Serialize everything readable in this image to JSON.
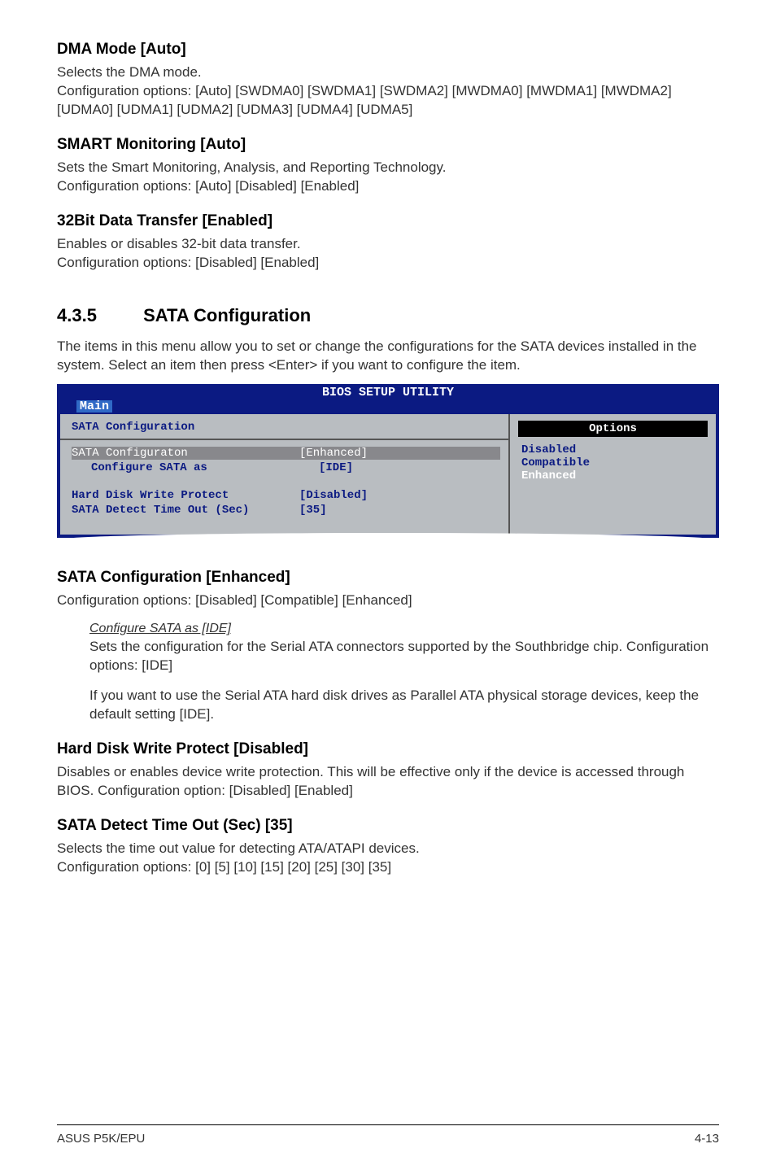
{
  "sections": {
    "dma": {
      "title": "DMA Mode [Auto]",
      "line1": "Selects the DMA mode.",
      "line2": "Configuration options: [Auto] [SWDMA0] [SWDMA1] [SWDMA2] [MWDMA0] [MWDMA1] [MWDMA2] [UDMA0] [UDMA1] [UDMA2] [UDMA3] [UDMA4] [UDMA5]"
    },
    "smart": {
      "title": "SMART Monitoring [Auto]",
      "line1": "Sets the Smart Monitoring, Analysis, and Reporting Technology.",
      "line2": "Configuration options: [Auto] [Disabled] [Enabled]"
    },
    "transfer": {
      "title": "32Bit Data Transfer [Enabled]",
      "line1": "Enables or disables 32-bit data transfer.",
      "line2": "Configuration options: [Disabled] [Enabled]"
    },
    "sataconfig": {
      "num": "4.3.5",
      "title": "SATA Configuration",
      "intro": "The items in this menu allow you to set or change the configurations for the SATA devices installed in the system. Select an item then press <Enter> if you want to configure the item."
    },
    "sataenhanced": {
      "title": "SATA Configuration [Enhanced]",
      "line1": "Configuration options: [Disabled] [Compatible] [Enhanced]",
      "sub_title": "Configure SATA as [IDE]",
      "sub_line1": "Sets the configuration for the Serial ATA connectors supported by the Southbridge chip. Configuration options: [IDE]",
      "sub_line2": "If you want to use the Serial ATA hard disk drives as Parallel ATA physical storage devices, keep the default setting [IDE]."
    },
    "hdwp": {
      "title": "Hard Disk Write Protect [Disabled]",
      "line1": "Disables or enables device write protection. This will be effective only if the device is accessed through BIOS. Configuration option: [Disabled] [Enabled]"
    },
    "detect": {
      "title": "SATA Detect Time Out (Sec) [35]",
      "line1": "Selects the time out value for detecting ATA/ATAPI devices.",
      "line2": "Configuration options: [0] [5] [10] [15] [20] [25] [30] [35]"
    }
  },
  "bios": {
    "header": "BIOS SETUP UTILITY",
    "tab": "Main",
    "panel_title": "SATA Configuration",
    "rows": [
      {
        "label": "SATA Configuraton",
        "value": "[Enhanced]",
        "highlighted": true
      },
      {
        "label": "Configure SATA as",
        "value": "[IDE]",
        "highlighted": false,
        "indent": true
      },
      {
        "label": "",
        "value": "",
        "gap": true
      },
      {
        "label": "Hard Disk Write Protect",
        "value": "[Disabled]",
        "highlighted": false
      },
      {
        "label": "SATA Detect Time Out (Sec)",
        "value": "[35]",
        "highlighted": false
      }
    ],
    "options_title": "Options",
    "options": [
      "Disabled",
      "Compatible",
      "Enhanced"
    ]
  },
  "footer": {
    "left": "ASUS P5K/EPU",
    "right": "4-13"
  }
}
